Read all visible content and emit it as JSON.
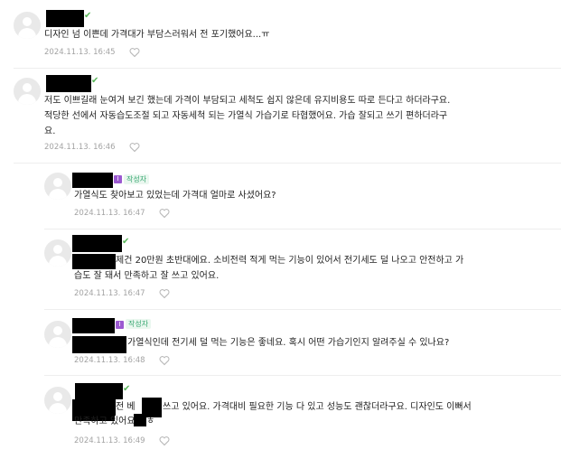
{
  "comments": [
    {
      "text_line1": "디자인 넘 이쁜데 가격대가 부담스러워서 전 포기했어요...ㅠ",
      "date": "2024.11.13. 16:45",
      "like_icon": "heart-outline-icon"
    },
    {
      "text_line1": "저도 이쁘길래 눈여겨 보긴 했는데 가격이 부담되고 세척도 쉽지 않은데 유지비용도 따로 든다고 하더라구요.",
      "text_line2": "적당한 선에서 자동습도조절 되고 자동세척 되는 가열식 가습기로 타협했어요. 가습 잘되고 쓰기 편하더라구",
      "text_line3": "요.",
      "date": "2024.11.13. 16:46"
    },
    {
      "author_badge": "작성자",
      "text_line1": "가열식도 찾아보고 있었는데 가격대 얼마로 사셨어요?",
      "date": "2024.11.13. 16:47"
    },
    {
      "text_line1_suffix": "제건 20만원 초반대에요. 소비전력 적게 먹는 기능이 있어서 전기세도 덜 나오고 안전하고 가",
      "text_line2": "습도 잘 돼서 만족하고 잘 쓰고 있어요.",
      "date": "2024.11.13. 16:47"
    },
    {
      "author_badge": "작성자",
      "text_line1_suffix": "가열식인데 전기세 덜 먹는 기능은 좋네요. 혹시 어떤 가습기인지 알려주실 수 있나요?",
      "date": "2024.11.13. 16:48"
    },
    {
      "text_a": "전 베",
      "text_b": "쓰고 있어요. 가격대비 필요한 기능 다 있고 성능도 괜찮더라구요. 디자인도 이뻐서",
      "text_line2": "만족하고 있어요 ㅎㅎ",
      "date": "2024.11.13. 16:49"
    }
  ],
  "colors": {
    "verified": "#5cb85c",
    "author_badge": "#3aa873",
    "author_mark": "#9b59d0",
    "meta": "#a3a3a3"
  }
}
